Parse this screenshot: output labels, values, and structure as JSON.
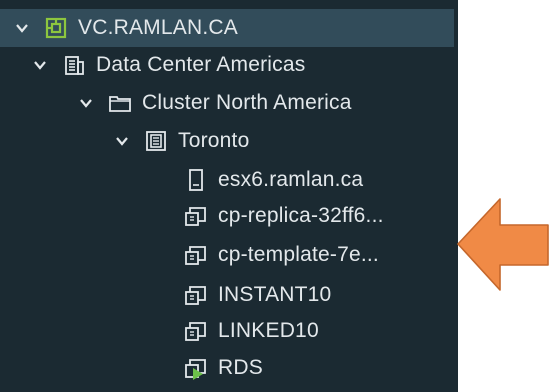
{
  "tree": {
    "items": [
      {
        "label": "VC.RAMLAN.CA",
        "icon": "vcenter-icon",
        "expanded": true,
        "level": 0,
        "selected": true
      },
      {
        "label": "Data Center Americas",
        "icon": "datacenter-icon",
        "expanded": true,
        "level": 1
      },
      {
        "label": "Cluster North America",
        "icon": "cluster-icon",
        "expanded": true,
        "level": 2
      },
      {
        "label": "Toronto",
        "icon": "resource-pool-icon",
        "expanded": true,
        "level": 3
      },
      {
        "label": "esx6.ramlan.ca",
        "icon": "host-icon",
        "level": 4
      },
      {
        "label": "cp-replica-32ff6...",
        "icon": "vm-icon",
        "level": 4
      },
      {
        "label": "cp-template-7e...",
        "icon": "vm-icon",
        "level": 4
      },
      {
        "label": "INSTANT10",
        "icon": "vm-icon",
        "level": 4
      },
      {
        "label": "LINKED10",
        "icon": "vm-icon",
        "level": 4
      },
      {
        "label": "RDS",
        "icon": "vm-powered-on-icon",
        "level": 4
      }
    ]
  },
  "colors": {
    "panel_bg": "#1b2a32",
    "selected_bg": "#324c5a",
    "text": "#e3e8eb",
    "vcenter_icon": "#8dc63f",
    "power_on": "#6cc04a",
    "arrow_fill": "#f08a46",
    "arrow_stroke": "#c5672b"
  },
  "annotation": {
    "arrow_icon": "orange-left-arrow-icon"
  }
}
